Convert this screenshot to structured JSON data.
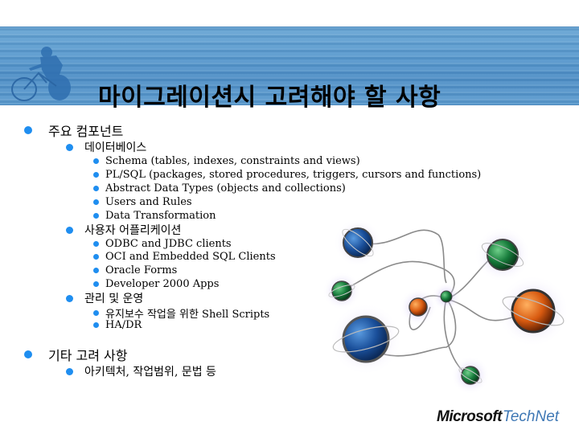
{
  "slide": {
    "title": "마이그레이션시 고려해야 할 사항",
    "header_image": "cyclist-photo",
    "illustration": "molecule-network-illustration",
    "accent_color": "#1f8ef0",
    "header_color": "#5b9bcf"
  },
  "outline": {
    "sections": [
      {
        "label": "주요 컴포넌트",
        "groups": [
          {
            "label": "데이터베이스",
            "items": [
              "Schema (tables, indexes, constraints and views)",
              "PL/SQL (packages, stored procedures, triggers, cursors and functions)",
              "Abstract Data Types (objects and collections)",
              "Users and Rules",
              "Data Transformation"
            ]
          },
          {
            "label": "사용자 어플리케이션",
            "items": [
              "ODBC and JDBC clients",
              "OCI and Embedded SQL Clients",
              "Oracle Forms",
              "Developer 2000 Apps"
            ]
          },
          {
            "label": "관리 및 운영",
            "items": [
              "유지보수 작업을 위한 Shell Scripts",
              "HA/DR"
            ]
          }
        ]
      },
      {
        "label": "기타 고려 사항",
        "groups": [
          {
            "label": "아키텍처, 작업범위, 문법 등",
            "items": []
          }
        ]
      }
    ]
  },
  "footer": {
    "logo_primary": "Microsoft",
    "logo_secondary": "TechNet"
  }
}
